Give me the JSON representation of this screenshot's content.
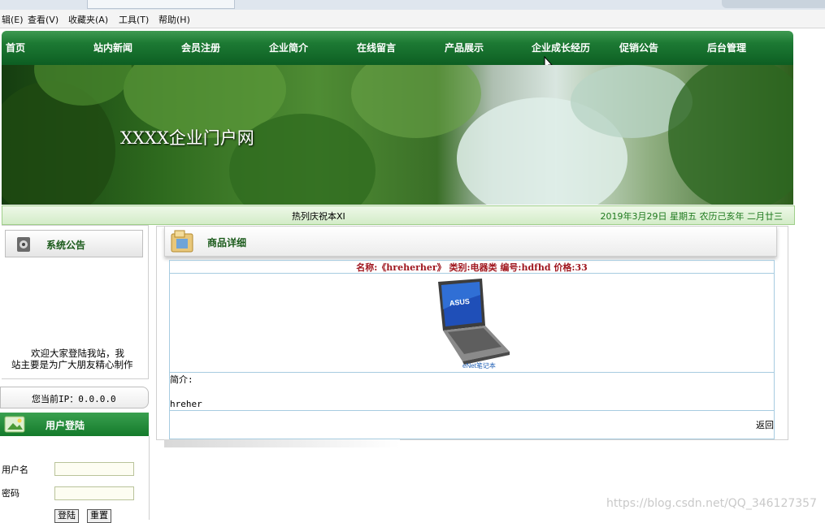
{
  "menu": {
    "items": [
      "辑(E)",
      "查看(V)",
      "收藏夹(A)",
      "工具(T)",
      "帮助(H)"
    ]
  },
  "nav": {
    "items": [
      "首页",
      "站内新闻",
      "会员注册",
      "企业简介",
      "在线留言",
      "产品展示",
      "企业成长经历",
      "促销公告",
      "后台管理"
    ]
  },
  "banner": {
    "title": "XXXX企业门户网"
  },
  "marquee": {
    "text": "热列庆祝本XI",
    "date": "2019年3月29日  星期五  农历己亥年  二月廿三"
  },
  "notice": {
    "title": "系统公告",
    "line1": "欢迎大家登陆我站，我",
    "line2": "站主要是为广大朋友精心制作"
  },
  "ip": {
    "label": "您当前IP：0.0.0.0"
  },
  "login": {
    "title": "用户登陆",
    "username_label": "用户名",
    "password_label": "密码",
    "login_button": "登陆",
    "reset_button": "重置"
  },
  "product": {
    "section_title": "商品详细",
    "header_line": "名称:《hreherher》 类别:电器类 编号:hdfhd 价格:33",
    "image_brand": "ASUS",
    "image_watermark": "eNet笔记本",
    "intro_label": "简介:",
    "intro_text": "hreher",
    "back_link": "返回"
  },
  "watermark": "https://blog.csdn.net/QQ_346127357",
  "colors": {
    "nav_green": "#1d7a34",
    "header_red": "#a0171f",
    "table_border": "#a7cce0",
    "date_green": "#1f7a1f"
  }
}
